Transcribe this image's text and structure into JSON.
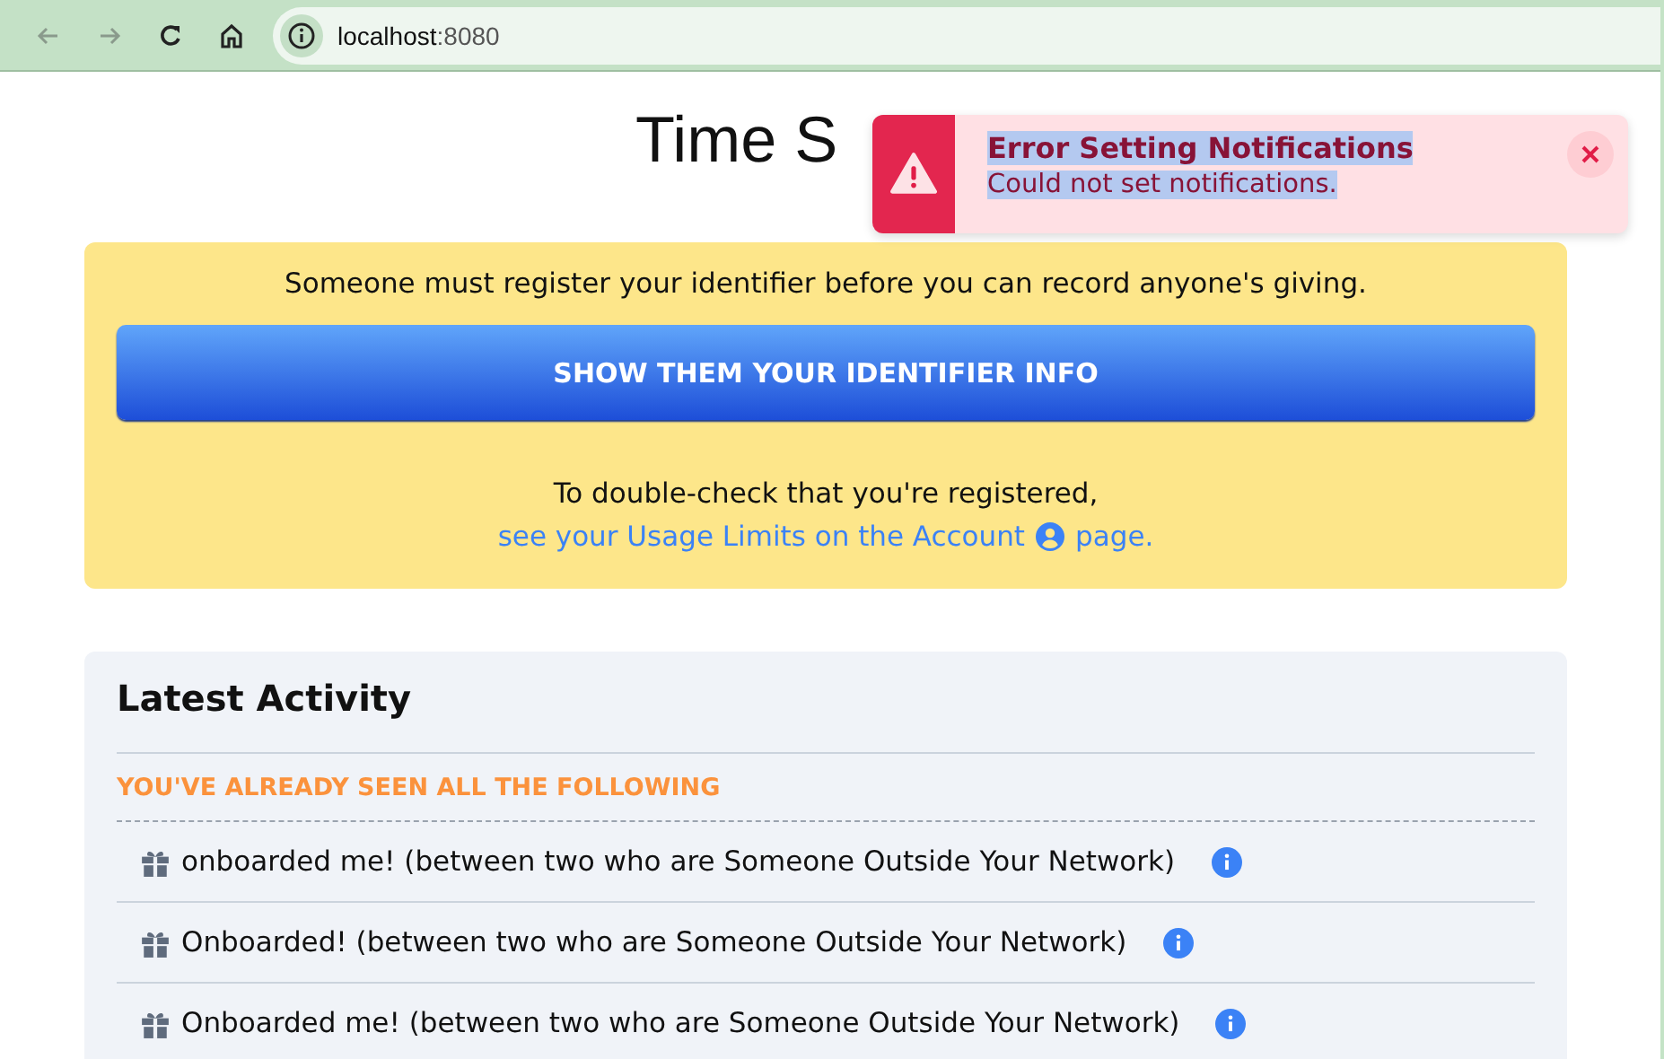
{
  "browser": {
    "url_host": "localhost",
    "url_port": ":8080"
  },
  "page": {
    "title": "Time S"
  },
  "toast": {
    "title": "Error Setting Notifications",
    "message": "Could not set notifications."
  },
  "notice": {
    "message": "Someone must register your identifier before you can record anyone's giving.",
    "button": "SHOW THEM YOUR IDENTIFIER INFO",
    "check_text": "To double-check that you're registered,",
    "link_before": "see your Usage Limits on the Account",
    "link_after": "page."
  },
  "activity": {
    "title": "Latest Activity",
    "section_label": "YOU'VE ALREADY SEEN ALL THE FOLLOWING",
    "items": [
      {
        "text": "onboarded me! (between two who are Someone Outside Your Network)"
      },
      {
        "text": "Onboarded! (between two who are Someone Outside Your Network)"
      },
      {
        "text": "Onboarded me! (between two who are Someone Outside Your Network)"
      }
    ]
  }
}
